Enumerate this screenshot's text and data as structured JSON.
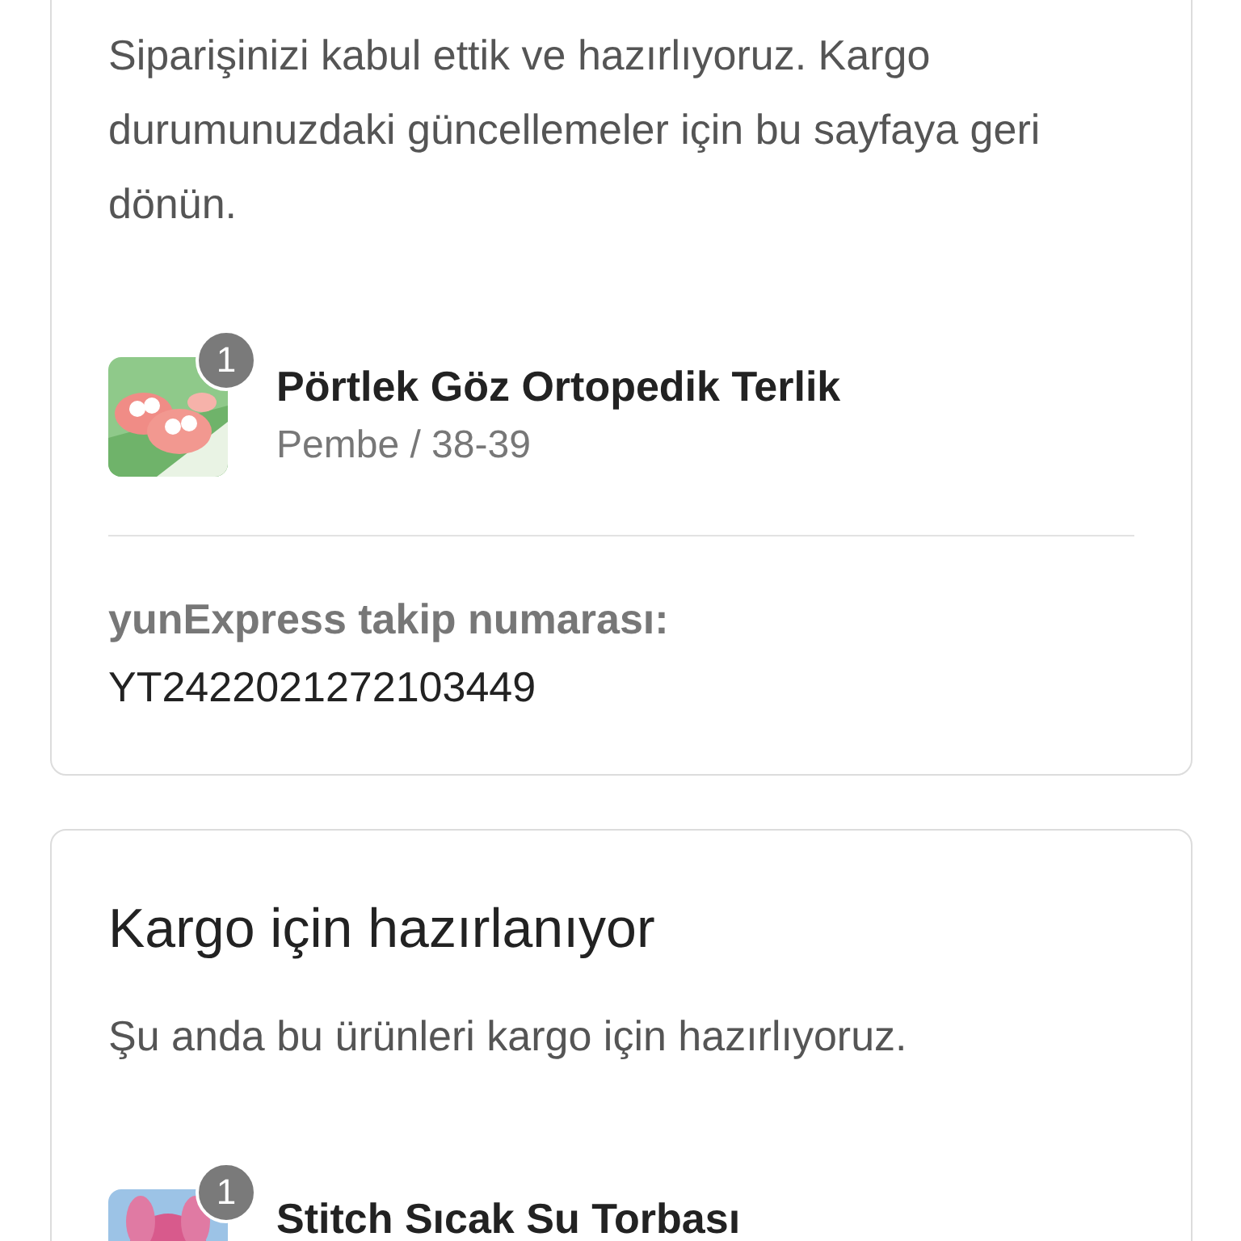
{
  "cards": [
    {
      "message": "Siparişinizi kabul ettik ve hazırlıyoruz. Kargo durumunuzdaki güncellemeler için bu sayfaya geri dönün.",
      "products": [
        {
          "name": "Pörtlek Göz Ortopedik Terlik",
          "variant": "Pembe / 38-39",
          "quantity": "1",
          "kind": "picture"
        }
      ],
      "tracking": {
        "label": "yunExpress takip numarası:",
        "number": "YT2422021272103449"
      }
    },
    {
      "title": "Kargo için hazırlanıyor",
      "message": "Şu anda bu ürünleri kargo için hazırlıyoruz.",
      "products": [
        {
          "name": "Stitch Sıcak Su Torbası",
          "quantity": "1",
          "kind": "picture"
        }
      ]
    }
  ]
}
